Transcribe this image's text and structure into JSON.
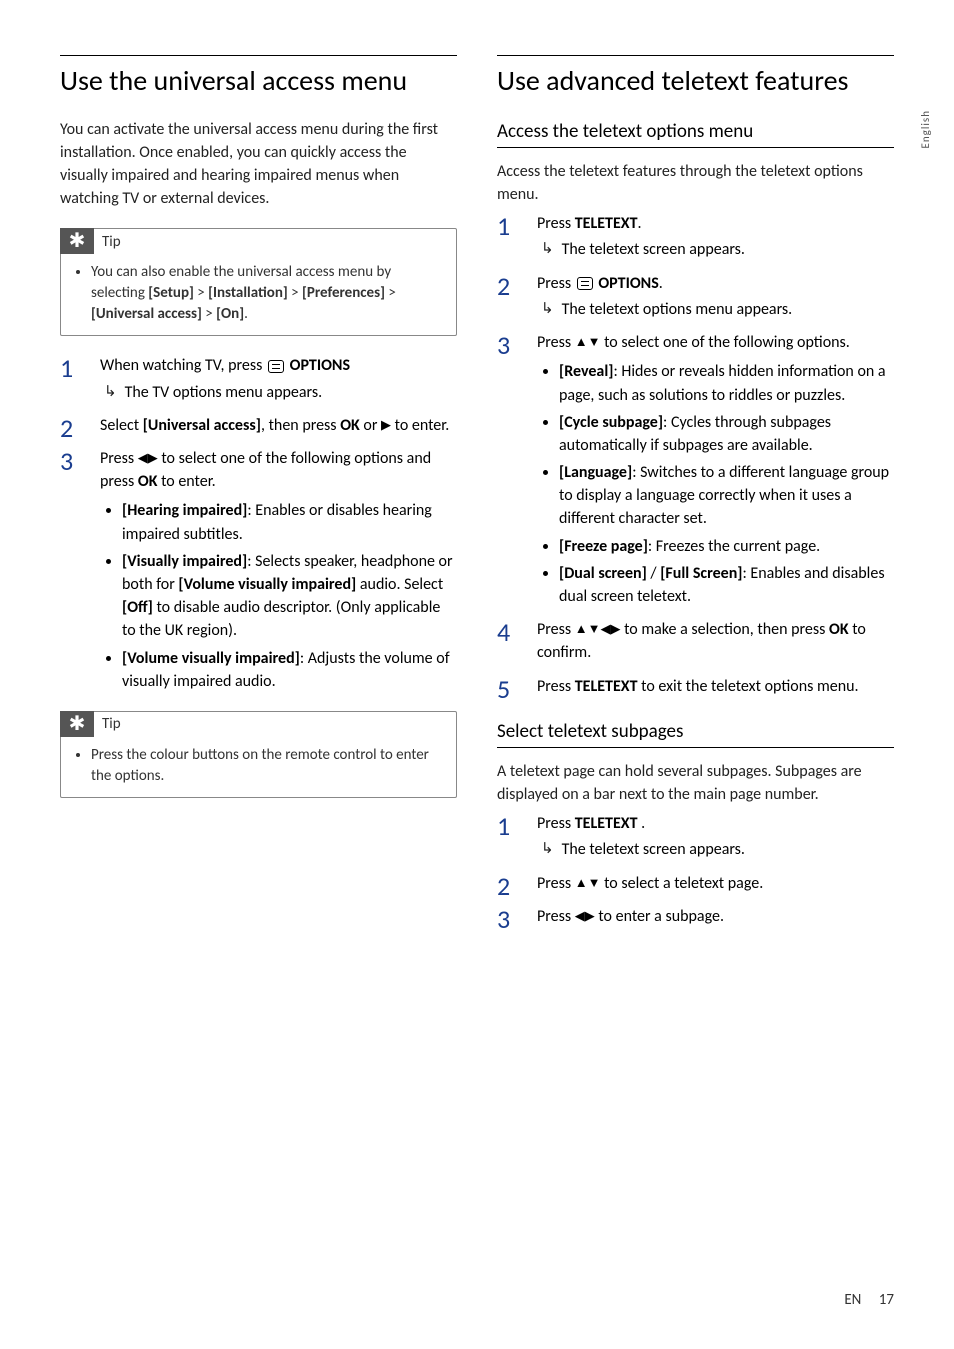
{
  "sidebar_lang": "English",
  "footer": {
    "lang": "EN",
    "page": "17"
  },
  "left": {
    "h1": "Use the universal access menu",
    "intro": "You can activate the universal access menu during the first installation. Once enabled, you can quickly access the visually impaired and hearing impaired menus when watching TV or external devices.",
    "tip1": {
      "label": "Tip",
      "text_pre": "You can also enable the universal access menu by selecting ",
      "setup": "[Setup]",
      "gt1": " > ",
      "installation": "[Installation]",
      "gt2": " > ",
      "preferences": "[Preferences]",
      "gt3": " > ",
      "ua": "[Universal access]",
      "gt4": " > ",
      "on": "[On]",
      "period": "."
    },
    "step1": {
      "num": "1",
      "text_pre": "When watching TV, press ",
      "options": " OPTIONS",
      "result": "The TV options menu appears."
    },
    "step2": {
      "num": "2",
      "text_pre": "Select ",
      "ua": "[Universal access]",
      "text_mid": ", then press ",
      "ok": "OK",
      "text_or": " or ",
      "arrow": "▶",
      "text_end": " to enter."
    },
    "step3": {
      "num": "3",
      "text_pre": "Press ",
      "arrows": "◀▶",
      "text_mid": " to select one of the following options and press ",
      "ok": "OK",
      "text_end": " to enter.",
      "b1_label": "[Hearing impaired]",
      "b1_text": ": Enables or disables hearing impaired subtitles.",
      "b2_label": "[Visually impaired]",
      "b2_text_a": ": Selects speaker, headphone or both for ",
      "b2_bold": "[Volume visually impaired]",
      "b2_text_b": " audio. Select ",
      "b2_off": "[Off]",
      "b2_text_c": " to disable audio descriptor. (Only applicable to the UK region).",
      "b3_label": "[Volume visually impaired]",
      "b3_text": ": Adjusts the volume of visually impaired audio."
    },
    "tip2": {
      "label": "Tip",
      "text": "Press the colour buttons on the remote control to enter the options."
    }
  },
  "right": {
    "h1": "Use advanced teletext features",
    "sec1": {
      "h2": "Access the teletext options menu",
      "intro": "Access the teletext features through the teletext options menu.",
      "step1": {
        "num": "1",
        "text_pre": "Press ",
        "teletext": "TELETEXT",
        "dot": ".",
        "result": "The teletext screen appears."
      },
      "step2": {
        "num": "2",
        "text_pre": "Press ",
        "options": " OPTIONS",
        "dot": ".",
        "result": "The teletext options menu appears."
      },
      "step3": {
        "num": "3",
        "text_pre": "Press ",
        "arrows": "▲▼",
        "text_end": " to select one of the following options.",
        "b1_label": "[Reveal]",
        "b1_text": ": Hides or reveals hidden information on a page, such as solutions to riddles or puzzles.",
        "b2_label": "[Cycle subpage]",
        "b2_text": ": Cycles through subpages automatically if subpages are available.",
        "b3_label": "[Language]",
        "b3_text": ": Switches to a different language group to display a language correctly when it uses a different character set.",
        "b4_label": "[Freeze page]",
        "b4_text": ": Freezes the current page.",
        "b5_label_a": "[Dual screen]",
        "b5_slash": " / ",
        "b5_label_b": "[Full Screen]",
        "b5_text": ": Enables and disables dual screen teletext."
      },
      "step4": {
        "num": "4",
        "text_pre": "Press ",
        "arrows": "▲▼◀▶",
        "text_mid": " to make a selection, then press ",
        "ok": "OK",
        "text_end": " to confirm."
      },
      "step5": {
        "num": "5",
        "text_pre": "Press ",
        "teletext": "TELETEXT",
        "text_end": " to exit the teletext options menu."
      }
    },
    "sec2": {
      "h2": "Select teletext subpages",
      "intro": "A teletext page can hold several subpages. Subpages are displayed on a bar next to the main page number.",
      "step1": {
        "num": "1",
        "text_pre": "Press ",
        "teletext": "TELETEXT",
        "dot": " .",
        "result": "The teletext screen appears."
      },
      "step2": {
        "num": "2",
        "text_pre": "Press ",
        "arrows": "▲▼",
        "text_end": " to select a teletext page."
      },
      "step3": {
        "num": "3",
        "text_pre": "Press ",
        "arrows": "◀▶",
        "text_end": " to enter a subpage."
      }
    }
  }
}
